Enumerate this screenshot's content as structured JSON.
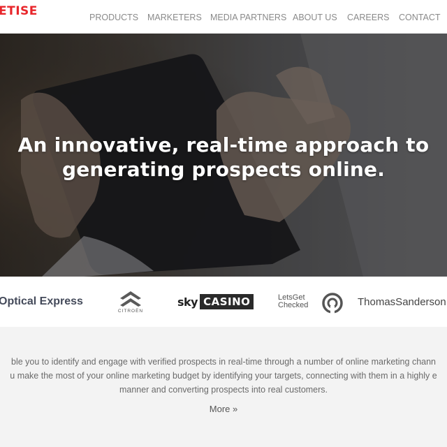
{
  "header": {
    "logo_text": "ETISE",
    "brand_color": "#e8262b",
    "nav": [
      {
        "label": "PRODUCTS"
      },
      {
        "label": "MARKETERS"
      },
      {
        "label": "MEDIA PARTNERS"
      },
      {
        "label": "ABOUT US"
      },
      {
        "label": "CAREERS"
      },
      {
        "label": "CONTACT"
      }
    ]
  },
  "hero": {
    "title_line1": "An innovative, real-time approach to",
    "title_line2": "generating prospects online."
  },
  "brands": {
    "optical": "Optical Express",
    "citroen": "CITROËN",
    "sky_word": "sky",
    "sky_casino": "CASINO",
    "letsget_1": "LetsGet",
    "letsget_2": "Checked",
    "thomas": "ThomasSanderson"
  },
  "content": {
    "line1": "ble you to identify and engage with verified prospects in real-time through a number of online marketing chann",
    "line2": "u make the most of your online marketing budget by identifying your targets, connecting with them in a highly e",
    "line3": "manner and converting prospects into real customers.",
    "more": "More »"
  }
}
